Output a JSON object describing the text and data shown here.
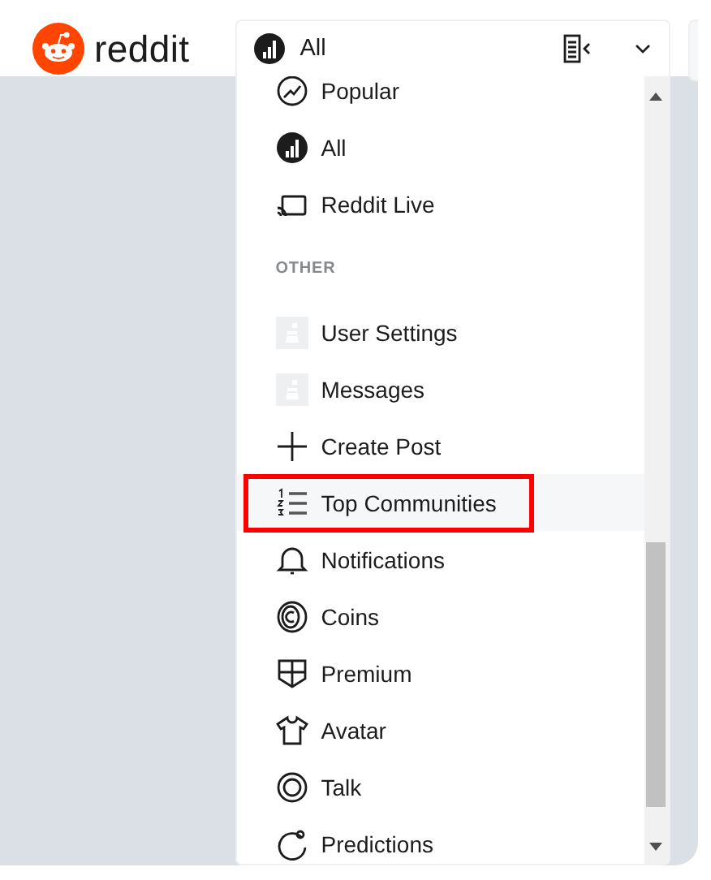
{
  "header": {
    "logo_text": "reddit",
    "feed_selector": {
      "label": "All",
      "expanded": true
    }
  },
  "menu": {
    "top_items": [
      {
        "kind": "popular",
        "label": "Popular",
        "highlighted": false
      },
      {
        "kind": "all",
        "label": "All",
        "highlighted": false
      },
      {
        "kind": "live",
        "label": "Reddit Live",
        "highlighted": false
      }
    ],
    "section_title": "OTHER",
    "other_items": [
      {
        "kind": "avatar",
        "label": "User Settings",
        "highlighted": false
      },
      {
        "kind": "avatar",
        "label": "Messages",
        "highlighted": false
      },
      {
        "kind": "plus",
        "label": "Create Post",
        "highlighted": false
      },
      {
        "kind": "ranking",
        "label": "Top Communities",
        "highlighted": true
      },
      {
        "kind": "bell",
        "label": "Notifications",
        "highlighted": false
      },
      {
        "kind": "coin",
        "label": "Coins",
        "highlighted": false
      },
      {
        "kind": "shield",
        "label": "Premium",
        "highlighted": false
      },
      {
        "kind": "shirt",
        "label": "Avatar",
        "highlighted": false
      },
      {
        "kind": "talk",
        "label": "Talk",
        "highlighted": false
      },
      {
        "kind": "predictions",
        "label": "Predictions",
        "highlighted": false
      }
    ]
  }
}
